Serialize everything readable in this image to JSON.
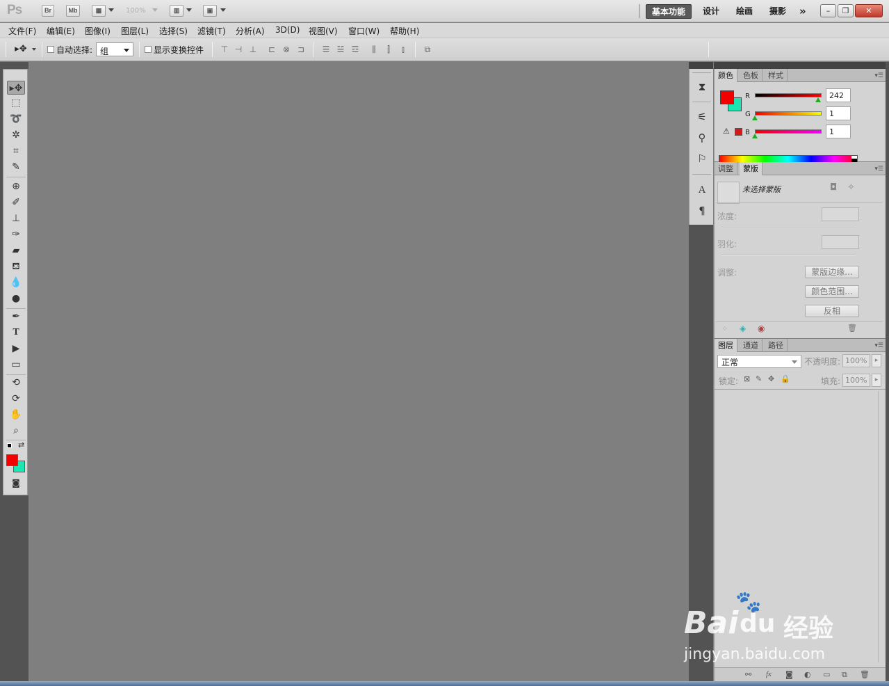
{
  "app": {
    "logo": "Ps",
    "bridge_btn": "Br",
    "minibridge_btn": "Mb",
    "zoom": "100%",
    "workspaces": [
      "基本功能",
      "设计",
      "绘画",
      "摄影"
    ],
    "more": "»"
  },
  "menu": [
    "文件(F)",
    "编辑(E)",
    "图像(I)",
    "图层(L)",
    "选择(S)",
    "滤镜(T)",
    "分析(A)",
    "3D(D)",
    "视图(V)",
    "窗口(W)",
    "帮助(H)"
  ],
  "options": {
    "auto_select_label": "自动选择:",
    "auto_select_value": "组",
    "show_transform_label": "显示变换控件"
  },
  "colors": {
    "foreground": "#f20101",
    "background": "#19e8b2"
  },
  "color_panel": {
    "tabs": [
      "颜色",
      "色板",
      "样式"
    ],
    "r_label": "R",
    "g_label": "G",
    "b_label": "B",
    "r": "242",
    "g": "1",
    "b": "1"
  },
  "mask_panel": {
    "tabs": [
      "调整",
      "蒙版"
    ],
    "status": "未选择蒙版",
    "density_label": "浓度:",
    "feather_label": "羽化:",
    "refine_label": "调整:",
    "mask_edge": "蒙版边缘...",
    "color_range": "颜色范围...",
    "invert": "反相"
  },
  "layers_panel": {
    "tabs": [
      "图层",
      "通道",
      "路径"
    ],
    "blend_mode": "正常",
    "opacity_label": "不透明度:",
    "opacity": "100%",
    "lock_label": "锁定:",
    "fill_label": "填充:",
    "fill": "100%",
    "footer_fx": "fx"
  },
  "watermark": {
    "brand": "Bai",
    "brand2": "du",
    "product": "经验",
    "url": "jingyan.baidu.com"
  }
}
